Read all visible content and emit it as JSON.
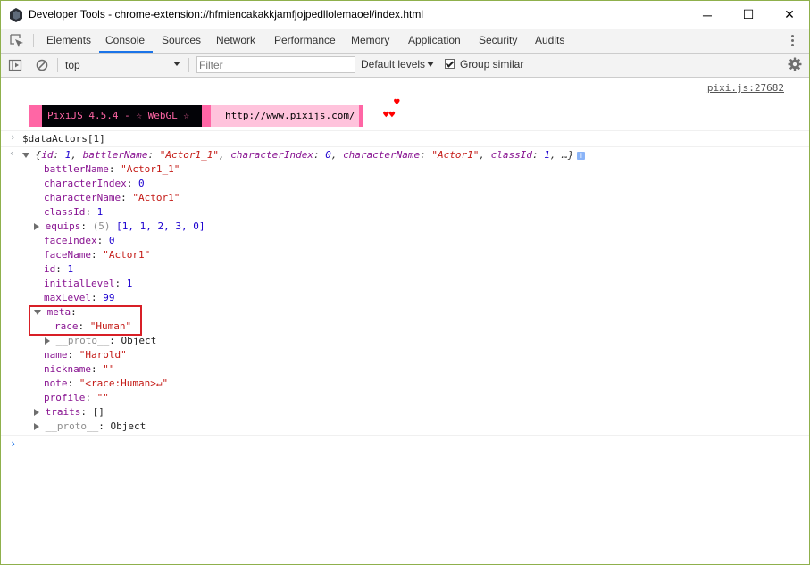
{
  "window": {
    "title": "Developer Tools - chrome-extension://hfmiencakakkjamfjojpedllolemaoel/index.html",
    "controls": {
      "minimize": "─",
      "maximize": "☐",
      "close": "✕"
    }
  },
  "tabs": [
    {
      "label": "Elements"
    },
    {
      "label": "Console"
    },
    {
      "label": "Sources"
    },
    {
      "label": "Network"
    },
    {
      "label": "Performance"
    },
    {
      "label": "Memory"
    },
    {
      "label": "Application"
    },
    {
      "label": "Security"
    },
    {
      "label": "Audits"
    }
  ],
  "active_tab": "Console",
  "toolbar": {
    "context": "top",
    "filter_placeholder": "Filter",
    "levels": "Default levels",
    "group_similar": "Group similar",
    "group_similar_checked": true
  },
  "console": {
    "source_link": "pixi.js:27682",
    "banner": {
      "left_text": "PixiJS 4.5.4 - ☆ WebGL ☆",
      "url": "http://www.pixijs.com/",
      "hearts_top": "♥",
      "hearts_bottom": "♥♥"
    },
    "command": "$dataActors[1]",
    "summary": {
      "open": "{",
      "p1k": "id",
      "p1v": "1",
      "p2k": "battlerName",
      "p2v": "\"Actor1_1\"",
      "p3k": "characterIndex",
      "p3v": "0",
      "p4k": "characterName",
      "p4v": "\"Actor1\"",
      "p5k": "classId",
      "p5v": "1",
      "close": "…}",
      "info": "i"
    },
    "props": {
      "battlerName": {
        "key": "battlerName",
        "value": "\"Actor1_1\""
      },
      "characterIndex": {
        "key": "characterIndex",
        "value": "0"
      },
      "characterName": {
        "key": "characterName",
        "value": "\"Actor1\""
      },
      "classId": {
        "key": "classId",
        "value": "1"
      },
      "equips": {
        "key": "equips",
        "count": "(5)",
        "value": "[1, 1, 2, 3, 0]"
      },
      "faceIndex": {
        "key": "faceIndex",
        "value": "0"
      },
      "faceName": {
        "key": "faceName",
        "value": "\"Actor1\""
      },
      "id": {
        "key": "id",
        "value": "1"
      },
      "initialLevel": {
        "key": "initialLevel",
        "value": "1"
      },
      "maxLevel": {
        "key": "maxLevel",
        "value": "99"
      },
      "meta": {
        "key": "meta"
      },
      "race": {
        "key": "race",
        "value": "\"Human\""
      },
      "meta_proto": {
        "key": "__proto__",
        "value": "Object"
      },
      "name": {
        "key": "name",
        "value": "\"Harold\""
      },
      "nickname": {
        "key": "nickname",
        "value": "\"\""
      },
      "note": {
        "key": "note",
        "value": "\"<race:Human>↵\""
      },
      "profile": {
        "key": "profile",
        "value": "\"\""
      },
      "traits": {
        "key": "traits",
        "value": "[]"
      },
      "proto": {
        "key": "__proto__",
        "value": "Object"
      }
    }
  },
  "colors": {
    "accent": "#1a73e8",
    "highlight_box": "#d81f26",
    "pixi_pink": "#ff66a5"
  }
}
